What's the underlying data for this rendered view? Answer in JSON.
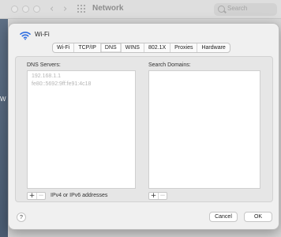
{
  "background_window": {
    "title": "Network",
    "search_placeholder": "Search",
    "side_letter": "W"
  },
  "sheet": {
    "title": "Wi-Fi",
    "tabs": [
      {
        "label": "Wi-Fi",
        "active": false
      },
      {
        "label": "TCP/IP",
        "active": false
      },
      {
        "label": "DNS",
        "active": true
      },
      {
        "label": "WINS",
        "active": false
      },
      {
        "label": "802.1X",
        "active": false
      },
      {
        "label": "Proxies",
        "active": false
      },
      {
        "label": "Hardware",
        "active": false
      }
    ],
    "dns": {
      "label": "DNS Servers:",
      "servers": [
        "192.168.1.1",
        "fe80::5692:9ff:fe91:4c18"
      ],
      "hint": "IPv4 or IPv6 addresses"
    },
    "search_domains": {
      "label": "Search Domains:",
      "domains": []
    },
    "controls": {
      "add": "+",
      "remove": "−"
    },
    "footer": {
      "help": "?",
      "cancel": "Cancel",
      "ok": "OK"
    }
  },
  "colors": {
    "sheet_bg": "#f0f0f0",
    "panel_bg": "#e6e6e6",
    "list_bg": "#ffffff",
    "muted_text": "#b5b5b5",
    "wifi_icon": "#2f6ee0"
  }
}
